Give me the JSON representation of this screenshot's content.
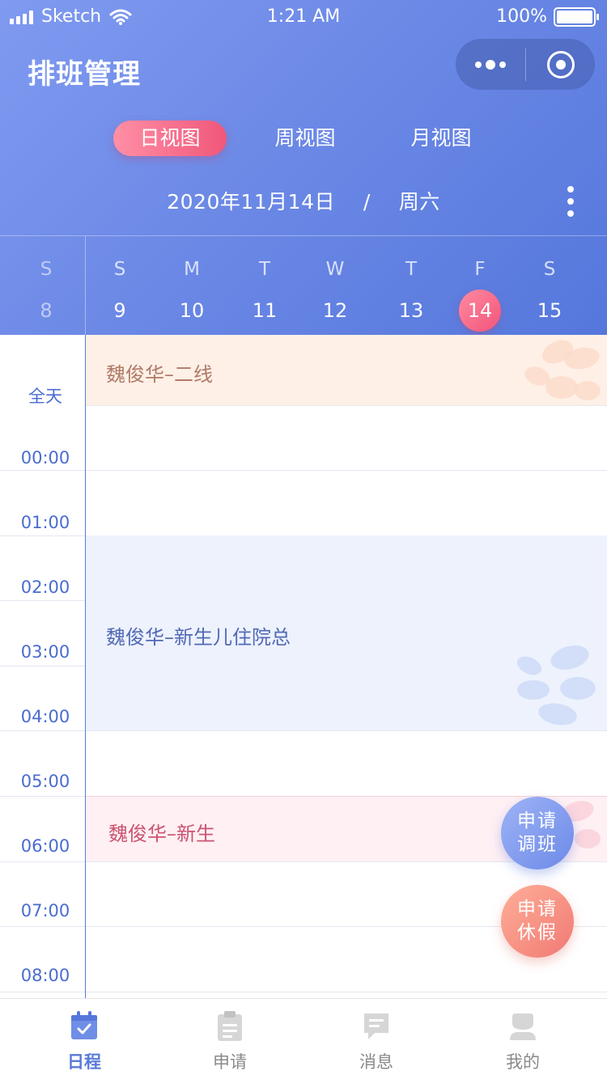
{
  "status_bar": {
    "carrier": "Sketch",
    "time": "1:21 AM",
    "battery": "100%"
  },
  "header": {
    "title": "排班管理"
  },
  "view_tabs": [
    {
      "label": "日视图"
    },
    {
      "label": "周视图"
    },
    {
      "label": "月视图"
    }
  ],
  "date": {
    "text": "2020年11月14日",
    "sep": "/",
    "weekday": "周六"
  },
  "week": {
    "days": [
      {
        "letter": "S",
        "num": "8"
      },
      {
        "letter": "S",
        "num": "9"
      },
      {
        "letter": "M",
        "num": "10"
      },
      {
        "letter": "T",
        "num": "11"
      },
      {
        "letter": "W",
        "num": "12"
      },
      {
        "letter": "T",
        "num": "13"
      },
      {
        "letter": "F",
        "num": "14"
      },
      {
        "letter": "S",
        "num": "15"
      }
    ]
  },
  "timeline": {
    "all_day_label": "全天",
    "hours": [
      "00:00",
      "01:00",
      "02:00",
      "03:00",
      "04:00",
      "05:00",
      "06:00",
      "07:00",
      "08:00"
    ]
  },
  "events": [
    {
      "text": "魏俊华–二线",
      "style": "orange"
    },
    {
      "text": "魏俊华–新生儿住院总",
      "style": "blue"
    },
    {
      "text": "魏俊华–新生",
      "style": "pink"
    }
  ],
  "fabs": {
    "shift": {
      "line1": "申请",
      "line2": "调班"
    },
    "leave": {
      "line1": "申请",
      "line2": "休假"
    }
  },
  "tabbar": [
    {
      "label": "日程"
    },
    {
      "label": "申请"
    },
    {
      "label": "消息"
    },
    {
      "label": "我的"
    }
  ],
  "colors": {
    "primary": "#5a79d9",
    "accent_pink": "#f0577a",
    "event_orange_bg": "#fff0e7",
    "event_blue_bg": "#edf2fd",
    "event_pink_bg": "#fff0f3"
  }
}
